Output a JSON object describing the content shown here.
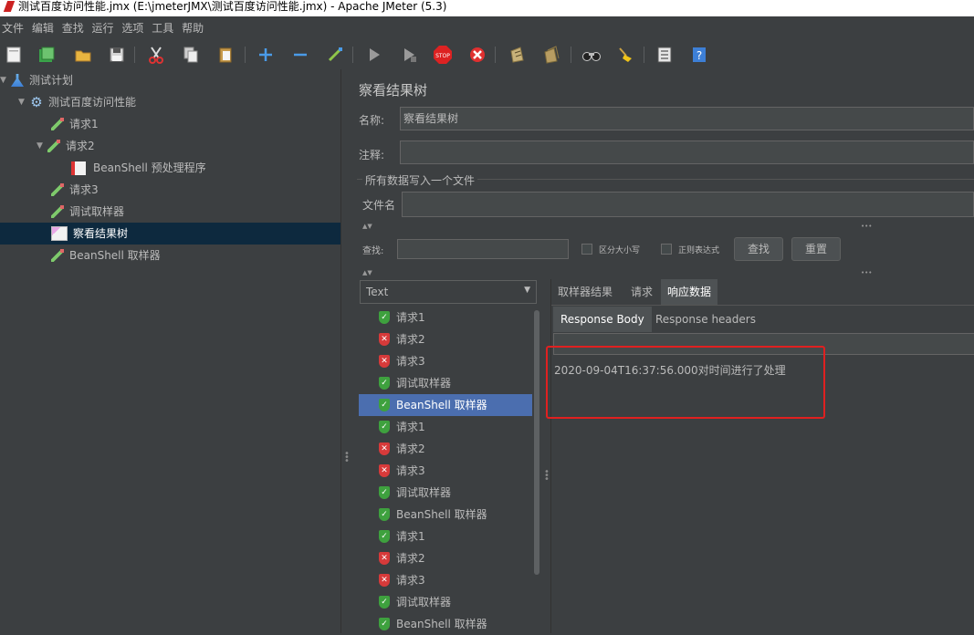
{
  "window": {
    "title": "测试百度访问性能.jmx (E:\\jmeterJMX\\测试百度访问性能.jmx) - Apache JMeter (5.3)"
  },
  "menu": [
    "文件",
    "编辑",
    "查找",
    "运行",
    "选项",
    "工具",
    "帮助"
  ],
  "toolbar": {
    "icons": [
      "new-template-icon",
      "templates-icon",
      "open-icon",
      "save-icon",
      "cut-icon",
      "copy-icon",
      "paste-icon",
      "add-icon",
      "remove-icon",
      "toggle-icon",
      "start-icon",
      "start-no-pause-icon",
      "stop-icon",
      "shutdown-icon",
      "clear-icon",
      "clear-all-icon",
      "search-icon",
      "reset-search-icon",
      "function-helper-icon",
      "help-icon"
    ]
  },
  "tree": {
    "items": [
      {
        "label": "测试计划"
      },
      {
        "label": "测试百度访问性能"
      },
      {
        "label": "请求1"
      },
      {
        "label": "请求2"
      },
      {
        "label": "BeanShell 预处理程序"
      },
      {
        "label": "请求3"
      },
      {
        "label": "调试取样器"
      },
      {
        "label": "察看结果树"
      },
      {
        "label": "BeanShell 取样器"
      }
    ]
  },
  "panel": {
    "title": "察看结果树",
    "name_label": "名称:",
    "name_value": "察看结果树",
    "comment_label": "注释:",
    "comment_value": "",
    "file_group_label": "所有数据写入一个文件",
    "filename_label": "文件名",
    "filename_value": ""
  },
  "search": {
    "label": "查找:",
    "value": "",
    "case_sensitive_label": "区分大小写",
    "regex_label": "正则表达式",
    "find_button": "查找",
    "reset_button": "重置"
  },
  "renderer": {
    "selected": "Text"
  },
  "results": [
    {
      "label": "请求1",
      "status": "ok"
    },
    {
      "label": "请求2",
      "status": "error"
    },
    {
      "label": "请求3",
      "status": "error"
    },
    {
      "label": "调试取样器",
      "status": "ok"
    },
    {
      "label": "BeanShell 取样器",
      "status": "ok",
      "selected": true
    },
    {
      "label": "请求1",
      "status": "ok"
    },
    {
      "label": "请求2",
      "status": "error"
    },
    {
      "label": "请求3",
      "status": "error"
    },
    {
      "label": "调试取样器",
      "status": "ok"
    },
    {
      "label": "BeanShell 取样器",
      "status": "ok"
    },
    {
      "label": "请求1",
      "status": "ok"
    },
    {
      "label": "请求2",
      "status": "error"
    },
    {
      "label": "请求3",
      "status": "error"
    },
    {
      "label": "调试取样器",
      "status": "ok"
    },
    {
      "label": "BeanShell 取样器",
      "status": "ok"
    }
  ],
  "tabs": {
    "items": [
      "取样器结果",
      "请求",
      "响应数据"
    ],
    "active": "响应数据"
  },
  "subtabs": {
    "items": [
      "Response Body",
      "Response headers"
    ],
    "active": "Response Body"
  },
  "response": {
    "body": "2020-09-04T16:37:56.000对时间进行了处理"
  },
  "colors": {
    "background": "#3c3f41",
    "selection": "#4b6eaf",
    "tree_selection": "#0d293e",
    "highlight_box": "#e02020",
    "ok": "#3ea13e",
    "error": "#d73a3a"
  }
}
